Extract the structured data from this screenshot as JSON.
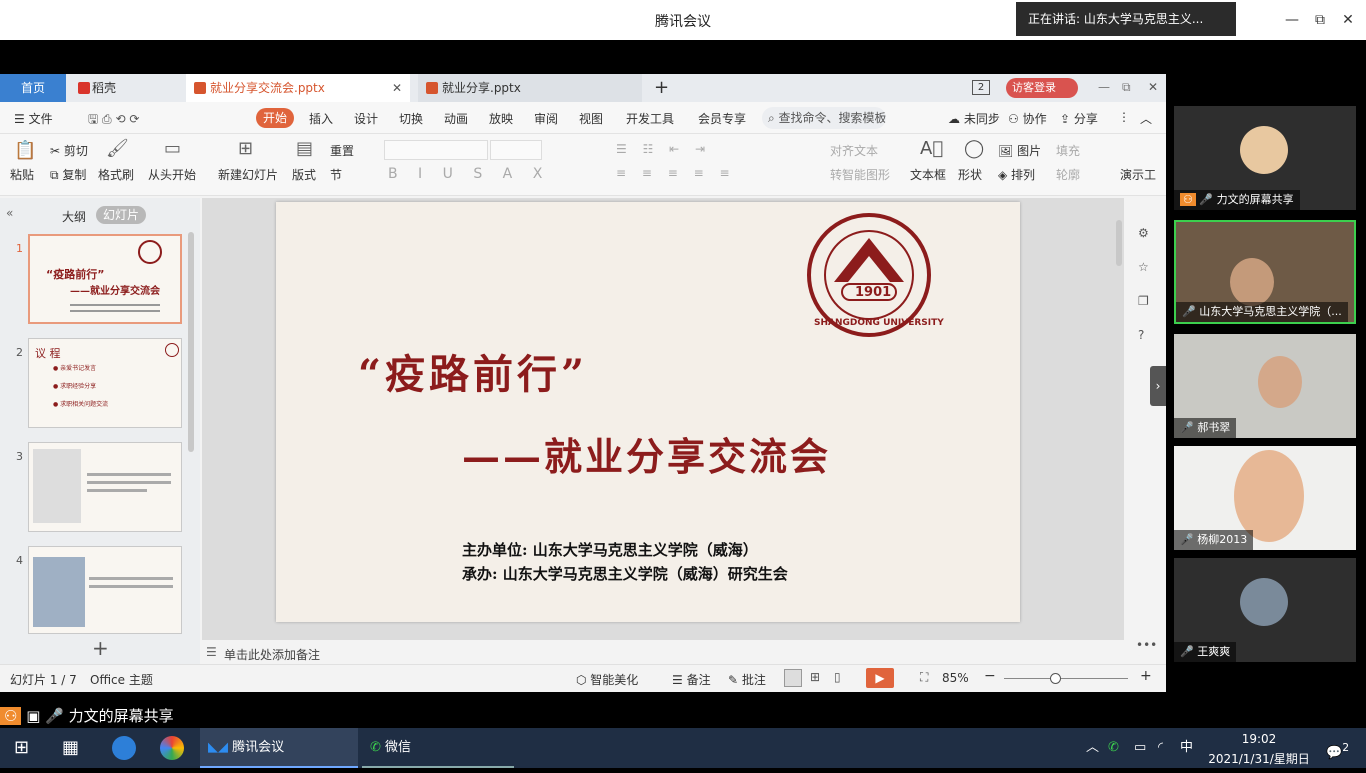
{
  "window": {
    "title": "腾讯会议",
    "speaking": "正在讲话: 山东大学马克思主义...",
    "minimize": "—",
    "restore": "⧉",
    "close": "✕"
  },
  "tabs": {
    "home": "首页",
    "daoke": "稻壳",
    "file1": "就业分享交流会.pptx",
    "file2": "就业分享.pptx",
    "add": "+",
    "visitor": "访客登录",
    "page_badge": "2"
  },
  "menu": {
    "file": "文件",
    "start": "开始",
    "items": [
      "插入",
      "设计",
      "切换",
      "动画",
      "放映",
      "审阅",
      "视图",
      "开发工具",
      "会员专享"
    ],
    "search": "查找命令、搜索模板",
    "unsync": "未同步",
    "collab": "协作",
    "share": "分享"
  },
  "ribbon": {
    "paste": "粘贴",
    "cut": "剪切",
    "copy": "复制",
    "format_brush": "格式刷",
    "from_start": "从头开始",
    "new_slide": "新建幻灯片",
    "layout": "版式",
    "reset": "重置",
    "section": "节",
    "align_text": "对齐文本",
    "smart_shape": "转智能图形",
    "textbox": "文本框",
    "shape": "形状",
    "picture": "图片",
    "arrange": "排列",
    "fill": "填充",
    "outline": "轮廓",
    "show_tools": "演示工"
  },
  "leftpane": {
    "outline": "大纲",
    "slides": "幻灯片",
    "add": "+",
    "thumbs": [
      {
        "num": "1",
        "title": "“疫路前行”",
        "subtitle": "——就业分享交流会"
      },
      {
        "num": "2",
        "title": "议 程",
        "items": [
          "亲爱书记发言",
          "求职经验分享",
          "求职相关问题交流"
        ]
      },
      {
        "num": "3"
      },
      {
        "num": "4"
      }
    ]
  },
  "slide": {
    "title": "“疫路前行”",
    "subtitle": "——就业分享交流会",
    "host": "主办单位: 山东大学马克思主义学院（威海）",
    "organizer": "承办: 山东大学马克思主义学院（威海）研究生会",
    "logo_year": "1901",
    "logo_text": "SHANGDONG UNIVERSITY"
  },
  "notes": {
    "placeholder": "单击此处添加备注"
  },
  "status": {
    "slide": "幻灯片 1 / 7",
    "theme": "Office 主题",
    "beautify": "智能美化",
    "notes": "备注",
    "comment": "批注",
    "zoom": "85%"
  },
  "gallery": [
    {
      "label": "力文的屏幕共享"
    },
    {
      "label": "山东大学马克思主义学院（..."
    },
    {
      "label": "郝书翠"
    },
    {
      "label": "杨柳2013"
    },
    {
      "label": "王爽爽"
    }
  ],
  "share_banner": "力文的屏幕共享",
  "taskbar": {
    "meeting": "腾讯会议",
    "wechat": "微信",
    "time": "19:02",
    "date": "2021/1/31/星期日",
    "ime": "中",
    "notif": "2"
  },
  "colors": {
    "accent": "#e0643c",
    "brand_red": "#8c1c1c",
    "taskbar": "#1f2e44"
  }
}
